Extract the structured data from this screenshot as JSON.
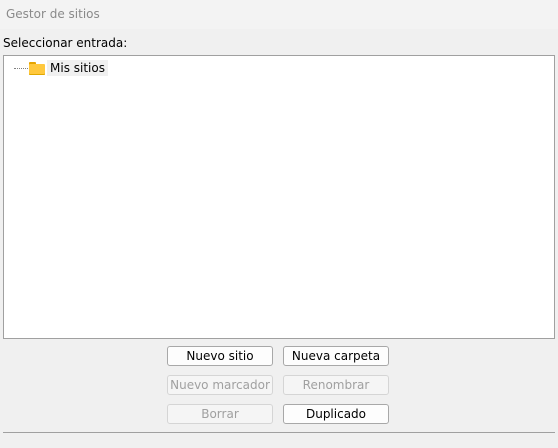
{
  "window": {
    "title": "Gestor de sitios"
  },
  "tree_panel": {
    "label": "Seleccionar entrada:",
    "nodes": [
      {
        "label": "Mis sitios",
        "icon": "folder-icon",
        "selected": true
      }
    ]
  },
  "buttons": {
    "new_site": {
      "label": "Nuevo sitio",
      "enabled": true
    },
    "new_folder": {
      "label": "Nueva carpeta",
      "enabled": true
    },
    "new_bookmark": {
      "label": "Nuevo marcador",
      "enabled": false
    },
    "rename": {
      "label": "Renombrar",
      "enabled": false
    },
    "delete": {
      "label": "Borrar",
      "enabled": false
    },
    "duplicate": {
      "label": "Duplicado",
      "enabled": true
    }
  },
  "colors": {
    "folder": "#ffc83d",
    "tree_background": "#ffffff",
    "window_background": "#f0f0f0",
    "disabled_text": "#a0a0a0"
  }
}
